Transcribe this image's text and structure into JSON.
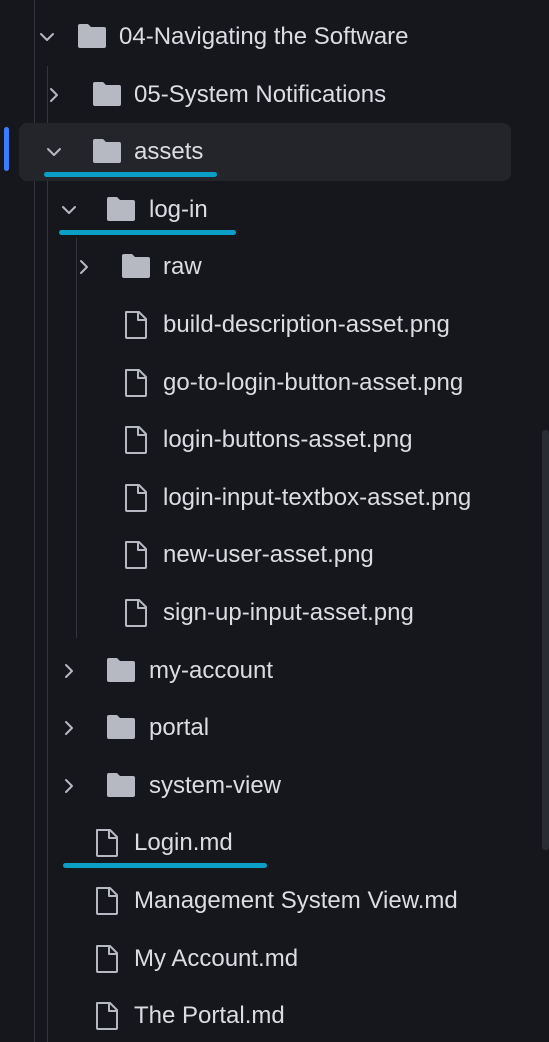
{
  "tree": [
    {
      "label": "04-Navigating the Software",
      "type": "folder",
      "expanded": true
    },
    {
      "label": "05-System Notifications",
      "type": "folder",
      "expanded": false
    },
    {
      "label": "assets",
      "type": "folder",
      "expanded": true,
      "selected": true,
      "highlighted": true
    },
    {
      "label": "log-in",
      "type": "folder",
      "expanded": true,
      "highlighted": true
    },
    {
      "label": "raw",
      "type": "folder",
      "expanded": false
    },
    {
      "label": "build-description-asset.png",
      "type": "file"
    },
    {
      "label": "go-to-login-button-asset.png",
      "type": "file"
    },
    {
      "label": "login-buttons-asset.png",
      "type": "file"
    },
    {
      "label": "login-input-textbox-asset.png",
      "type": "file"
    },
    {
      "label": "new-user-asset.png",
      "type": "file"
    },
    {
      "label": "sign-up-input-asset.png",
      "type": "file"
    },
    {
      "label": "my-account",
      "type": "folder",
      "expanded": false
    },
    {
      "label": "portal",
      "type": "folder",
      "expanded": false
    },
    {
      "label": "system-view",
      "type": "folder",
      "expanded": false
    },
    {
      "label": "Login.md",
      "type": "file",
      "highlighted": true
    },
    {
      "label": "Management System View.md",
      "type": "file"
    },
    {
      "label": "My Account.md",
      "type": "file"
    },
    {
      "label": "The Portal.md",
      "type": "file"
    }
  ],
  "colors": {
    "background": "#16171d",
    "text": "#dcdde3",
    "icon": "#b7b9c2",
    "highlight_underline": "#0b9fc7",
    "selected_row": "#23252b",
    "active_marker": "#3c7dff"
  }
}
